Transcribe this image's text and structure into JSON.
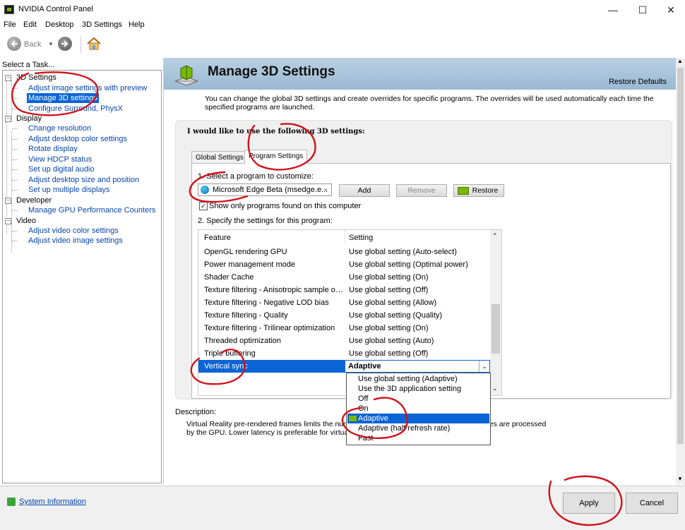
{
  "window": {
    "title": "NVIDIA Control Panel",
    "minimize": "—",
    "maximize": "☐",
    "close": "✕"
  },
  "menu": [
    "File",
    "Edit",
    "Desktop",
    "3D Settings",
    "Help"
  ],
  "toolbar": {
    "back_label": "Back"
  },
  "left": {
    "select_task": "Select a Task...",
    "tree": [
      {
        "label": "3D Settings",
        "kind": "cat"
      },
      {
        "label": "Adjust image settings with preview",
        "kind": "link"
      },
      {
        "label": "Manage 3D settings",
        "kind": "selected"
      },
      {
        "label": "Configure Surround, PhysX",
        "kind": "link"
      },
      {
        "label": "Display",
        "kind": "cat"
      },
      {
        "label": "Change resolution",
        "kind": "link"
      },
      {
        "label": "Adjust desktop color settings",
        "kind": "link"
      },
      {
        "label": "Rotate display",
        "kind": "link"
      },
      {
        "label": "View HDCP status",
        "kind": "link"
      },
      {
        "label": "Set up digital audio",
        "kind": "link"
      },
      {
        "label": "Adjust desktop size and position",
        "kind": "link"
      },
      {
        "label": "Set up multiple displays",
        "kind": "link"
      },
      {
        "label": "Developer",
        "kind": "cat"
      },
      {
        "label": "Manage GPU Performance Counters",
        "kind": "link"
      },
      {
        "label": "Video",
        "kind": "cat"
      },
      {
        "label": "Adjust video color settings",
        "kind": "link"
      },
      {
        "label": "Adjust video image settings",
        "kind": "link"
      }
    ]
  },
  "main": {
    "title": "Manage 3D Settings",
    "restore_defaults": "Restore Defaults",
    "intro": "You can change the global 3D settings and create overrides for specific programs. The overrides will be used automatically each time the specified programs are launched.",
    "would_like": "I would like to use the following 3D settings:",
    "tabs": {
      "global": "Global Settings",
      "program": "Program Settings"
    },
    "step1": "1. Select a program to customize:",
    "program_value": "Microsoft Edge Beta (msedge.e...",
    "buttons": {
      "add": "Add",
      "remove": "Remove",
      "restore": "Restore"
    },
    "only_found": "Show only programs found on this computer",
    "step2": "2. Specify the settings for this program:",
    "columns": {
      "feature": "Feature",
      "setting": "Setting"
    },
    "rows": [
      {
        "feature": "OpenGL rendering GPU",
        "setting": "Use global setting (Auto-select)"
      },
      {
        "feature": "Power management mode",
        "setting": "Use global setting (Optimal power)"
      },
      {
        "feature": "Shader Cache",
        "setting": "Use global setting (On)"
      },
      {
        "feature": "Texture filtering - Anisotropic sample opti...",
        "setting": "Use global setting (Off)"
      },
      {
        "feature": "Texture filtering - Negative LOD bias",
        "setting": "Use global setting (Allow)"
      },
      {
        "feature": "Texture filtering - Quality",
        "setting": "Use global setting (Quality)"
      },
      {
        "feature": "Texture filtering - Trilinear optimization",
        "setting": "Use global setting (On)"
      },
      {
        "feature": "Threaded optimization",
        "setting": "Use global setting (Auto)"
      },
      {
        "feature": "Triple buffering",
        "setting": "Use global setting (Off)"
      }
    ],
    "vsync": {
      "feature": "Vertical sync",
      "value": "Adaptive"
    },
    "vsync_options": [
      "Use global setting (Adaptive)",
      "Use the 3D application setting",
      "Off",
      "On",
      "Adaptive",
      "Adaptive (half refresh rate)",
      "Fast"
    ],
    "vsync_selected_index": 4,
    "description_label": "Description:",
    "description_line1": "Virtual Reality pre-rendered frames limits the numbe",
    "description_line2": "by the GPU. Lower latency is preferable for virtual r",
    "description_tail": "mes are processed"
  },
  "bottom": {
    "system_info": "System Information",
    "apply": "Apply",
    "cancel": "Cancel"
  },
  "colors": {
    "accent": "#0a64d6",
    "header": "#9bb9d3",
    "nvidia_green": "#76b900",
    "annotation": "#d0121a"
  }
}
